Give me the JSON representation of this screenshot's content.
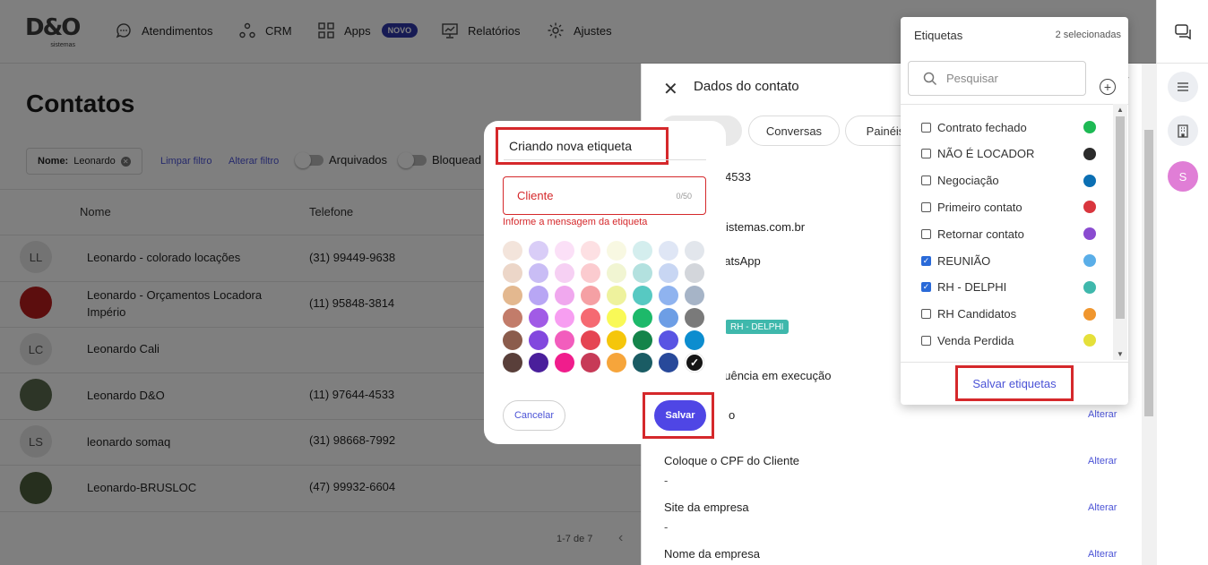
{
  "nav": {
    "logo_text": "D&O",
    "logo_sub": "sistemas",
    "items": [
      {
        "label": "Atendimentos",
        "icon": "chat-bubble-icon"
      },
      {
        "label": "CRM",
        "icon": "network-icon"
      },
      {
        "label": "Apps",
        "icon": "grid-icon",
        "badge": "NOVO"
      },
      {
        "label": "Relatórios",
        "icon": "chart-board-icon"
      },
      {
        "label": "Ajustes",
        "icon": "gear-icon"
      }
    ]
  },
  "right_sidebar": {
    "avatar_letter": "S",
    "avatar_color": "#e07ed6"
  },
  "contacts": {
    "title": "Contatos",
    "filter_label": "Nome:",
    "filter_value": "Leonardo",
    "clear_filter": "Limpar filtro",
    "change_filter": "Alterar filtro",
    "archived_label": "Arquivados",
    "blocked_label": "Bloquead",
    "columns": [
      "Nome",
      "Telefone"
    ],
    "rows": [
      {
        "initials": "LL",
        "name": "Leonardo - colorado locações",
        "phone": "(31) 99449-9638"
      },
      {
        "initials": "",
        "name": "Leonardo - Orçamentos Locadora Império",
        "phone": "(11) 95848-3814"
      },
      {
        "initials": "LC",
        "name": "Leonardo Cali",
        "phone": ""
      },
      {
        "initials": "",
        "name": "Leonardo D&O",
        "phone": "(11) 97644-4533"
      },
      {
        "initials": "LS",
        "name": "leonardo somaq",
        "phone": "(31) 98668-7992"
      },
      {
        "initials": "",
        "name": "Leonardo-BRUSLOC",
        "phone": "(47) 99932-6604"
      }
    ],
    "pagination": "1-7 de 7"
  },
  "contact_panel": {
    "title": "Dados do contato",
    "tabs": [
      "",
      "Conversas",
      "Painéis"
    ],
    "phone_partial": "4533",
    "email_partial": "dosistemas.com.br",
    "channel_partial": "hatsApp",
    "tag_pill": "RH - DELPHI",
    "sequence_partial": "quência em execução",
    "field_partial": "o",
    "fields": [
      {
        "label": "Coloque o CPF do Cliente",
        "value": "-",
        "action": "Alterar"
      },
      {
        "label": "Site da empresa",
        "value": "-",
        "action": "Alterar"
      },
      {
        "label": "Nome da empresa",
        "value": "",
        "action": "Alterar"
      }
    ],
    "first_action": "Alterar"
  },
  "new_tag_modal": {
    "title": "Criando nova etiqueta",
    "input_placeholder": "Cliente",
    "counter": "0/50",
    "error": "Informe a mensagem da etiqueta",
    "colors": [
      "#f3e4db",
      "#d9cdf7",
      "#fbe0f7",
      "#fde0e3",
      "#f8f8e2",
      "#d4eeee",
      "#dfe6f5",
      "#e2e6ec",
      "#ecd6c8",
      "#c9bdf5",
      "#f6d0f3",
      "#fbcbcf",
      "#f1f5d2",
      "#b3e1df",
      "#c8d6f3",
      "#d3d6db",
      "#e3b88f",
      "#b8a6f4",
      "#f0a8ee",
      "#f5a0a4",
      "#eef29d",
      "#57c9c2",
      "#8fb3ef",
      "#a6b4c7",
      "#c27c6a",
      "#a15be6",
      "#f79ef1",
      "#f56a72",
      "#f9f957",
      "#1db96a",
      "#6d9ee5",
      "#7a7a7a",
      "#8b5c4c",
      "#8248de",
      "#f25dbd",
      "#e54552",
      "#f5c60b",
      "#14844a",
      "#5954e3",
      "#0c8dcf",
      "#593f3a",
      "#4a1f9b",
      "#f01d8c",
      "#c73a57",
      "#f6a53b",
      "#1a5c64",
      "#28499a",
      "#0a3a80"
    ],
    "selected_color_index": 47,
    "selected_color": "#151515",
    "cancel": "Cancelar",
    "save": "Salvar"
  },
  "tags_dropdown": {
    "title": "Etiquetas",
    "selected_count": "2 selecionadas",
    "search_placeholder": "Pesquisar",
    "items": [
      {
        "label": "Contrato fechado",
        "checked": false,
        "color": "#1db954"
      },
      {
        "label": "NÃO É LOCADOR",
        "checked": false,
        "color": "#2b2b2b"
      },
      {
        "label": "Negociação",
        "checked": false,
        "color": "#0b6fb3"
      },
      {
        "label": "Primeiro contato",
        "checked": false,
        "color": "#d9363e"
      },
      {
        "label": "Retornar contato",
        "checked": false,
        "color": "#8a4bd0"
      },
      {
        "label": "REUNIÃO",
        "checked": true,
        "color": "#5aaee8"
      },
      {
        "label": "RH - DELPHI",
        "checked": true,
        "color": "#3fb8ac"
      },
      {
        "label": "RH Candidatos",
        "checked": false,
        "color": "#f0962e"
      },
      {
        "label": "Venda Perdida",
        "checked": false,
        "color": "#e5e03a"
      }
    ],
    "save": "Salvar etiquetas"
  }
}
